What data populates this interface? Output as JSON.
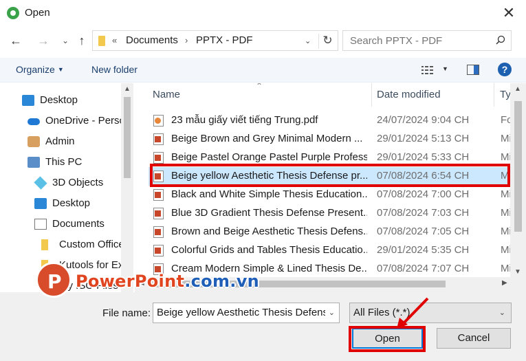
{
  "window": {
    "title": "Open",
    "close_glyph": "✕"
  },
  "address_bar": {
    "prefix": "«",
    "crumbs": [
      "Documents",
      "PPTX - PDF"
    ],
    "separator": "›"
  },
  "search": {
    "placeholder": "Search PPTX - PDF"
  },
  "toolbar": {
    "organize_label": "Organize",
    "new_folder_label": "New folder",
    "help_label": "?"
  },
  "sidebar": {
    "items": [
      {
        "label": "Desktop",
        "icon": "desktop-icon"
      },
      {
        "label": "OneDrive - Perso",
        "icon": "onedrive-icon"
      },
      {
        "label": "Admin",
        "icon": "user-folder-icon"
      },
      {
        "label": "This PC",
        "icon": "pc-icon"
      },
      {
        "label": "3D Objects",
        "icon": "3d-objects-icon"
      },
      {
        "label": "Desktop",
        "icon": "desktop-icon"
      },
      {
        "label": "Documents",
        "icon": "documents-icon"
      },
      {
        "label": "Custom Office",
        "icon": "folder-icon"
      },
      {
        "label": "Kutools for Ex",
        "icon": "folder-icon"
      },
      {
        "label": "My ISO Files",
        "icon": "folder-icon"
      }
    ]
  },
  "file_list": {
    "columns": [
      "Name",
      "Date modified",
      "Ty"
    ],
    "rows": [
      {
        "name": "23 mẫu giấy viết tiếng Trung.pdf",
        "date": "24/07/2024 9:04 CH",
        "type": "Fo",
        "icon": "pdf-icon"
      },
      {
        "name": "Beige Brown and Grey Minimal Modern ...",
        "date": "29/01/2024 5:13 CH",
        "type": "Mi",
        "icon": "pptx-icon"
      },
      {
        "name": "Beige Pastel Orange Pastel Purple Profess...",
        "date": "29/01/2024 5:33 CH",
        "type": "Mi",
        "icon": "pptx-icon"
      },
      {
        "name": "Beige yellow Aesthetic Thesis Defense pr...",
        "date": "07/08/2024 6:54 CH",
        "type": "Mi",
        "icon": "pptx-icon",
        "selected": true
      },
      {
        "name": "Black and White Simple Thesis Education...",
        "date": "07/08/2024 7:00 CH",
        "type": "Mi",
        "icon": "pptx-icon"
      },
      {
        "name": "Blue 3D Gradient Thesis Defense Present...",
        "date": "07/08/2024 7:03 CH",
        "type": "Mi",
        "icon": "pptx-icon"
      },
      {
        "name": "Brown and Beige Aesthetic Thesis Defens...",
        "date": "07/08/2024 7:05 CH",
        "type": "Mi",
        "icon": "pptx-icon"
      },
      {
        "name": "Colorful Grids and Tables Thesis Educatio...",
        "date": "29/01/2024 5:35 CH",
        "type": "Mi",
        "icon": "pptx-icon"
      },
      {
        "name": "Cream Modern Simple & Lined Thesis De...",
        "date": "07/08/2024 7:07 CH",
        "type": "Mi",
        "icon": "pptx-icon"
      }
    ]
  },
  "footer": {
    "file_name_label": "File name:",
    "file_name_value": "Beige yellow Aesthetic Thesis Defens",
    "file_type_value": "All Files (*.*)",
    "open_label": "Open",
    "cancel_label": "Cancel"
  },
  "watermark": {
    "logo_letter": "P",
    "text_main": "PowerPoint",
    "text_suffix": ".com.vn"
  },
  "colors": {
    "selection": "#cce8ff",
    "annotation": "#e00000",
    "accent": "#0078d7"
  }
}
